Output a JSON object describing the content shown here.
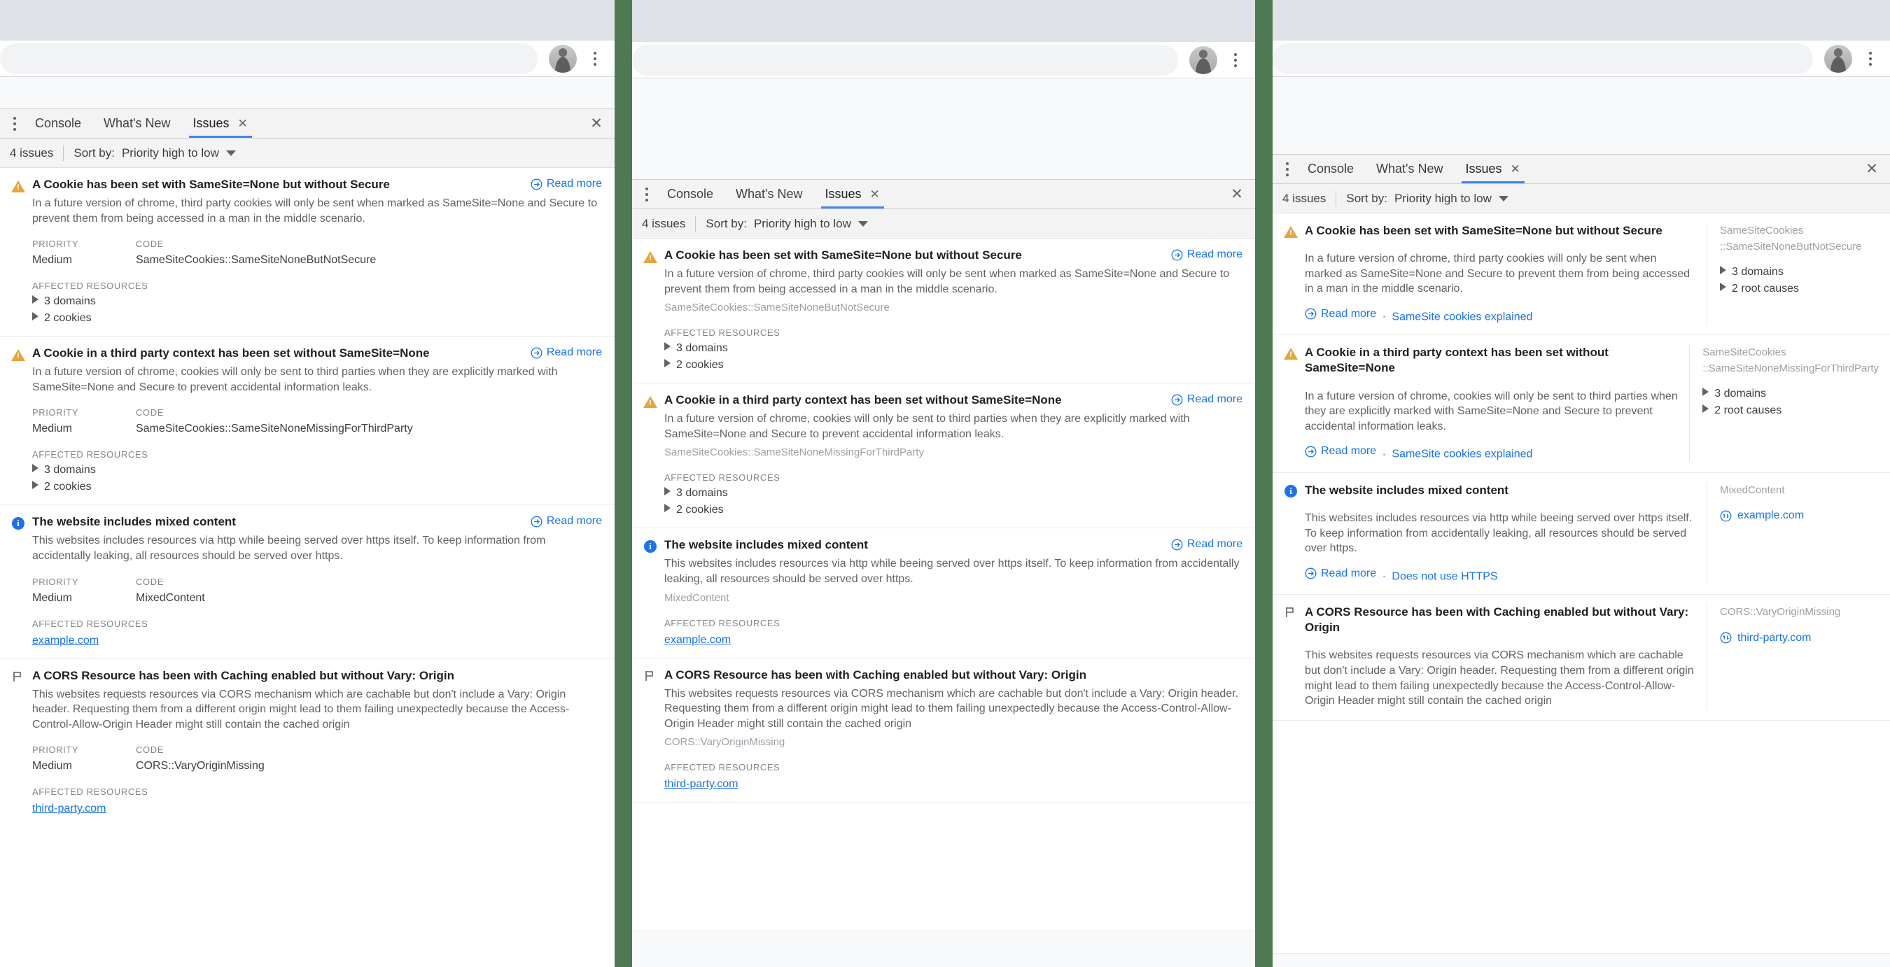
{
  "meta": {
    "divider_color": "#4d7a52",
    "accent_color": "#1a73e8",
    "warning_color": "#e8a33d",
    "tab_underline_color": "#4285f4"
  },
  "devtools": {
    "tabs": [
      {
        "label": "Console",
        "active": false
      },
      {
        "label": "What's New",
        "active": false
      },
      {
        "label": "Issues",
        "active": true,
        "close_glyph": "✕"
      }
    ],
    "close_all_glyph": "✕",
    "toolbar": {
      "issue_count": "4 issues",
      "sort_label": "Sort by:",
      "sort_value": "Priority high to low"
    },
    "labels": {
      "priority": "PRIORITY",
      "code": "CODE",
      "affected_resources": "AFFECTED RESOURCES",
      "read_more": "Read more",
      "separator": "·"
    }
  },
  "issues": [
    {
      "icon": "warning-icon",
      "title": "A Cookie has been set with SameSite=None but without Secure",
      "description": "In a future version of chrome, third party cookies will only be sent when marked as SameSite=None and Secure to prevent them from being accessed in a man in the middle scenario.",
      "priority": "Medium",
      "code": "SameSiteCookies::SameSiteNoneButNotSecure",
      "code_line1": "SameSiteCookies",
      "code_line2": "::SameSiteNoneButNotSecure",
      "resources_a": [
        "3 domains",
        "2 cookies"
      ],
      "resources_c": [
        "3 domains",
        "2 root causes"
      ],
      "read_more": "Read more",
      "explainer": "SameSite cookies explained"
    },
    {
      "icon": "warning-icon",
      "title": "A Cookie in a third party context has been set without SameSite=None",
      "description": "In a future version of chrome, cookies will only be sent to third parties when they are explicitly marked with SameSite=None and Secure to prevent accidental information leaks.",
      "priority": "Medium",
      "code": "SameSiteCookies::SameSiteNoneMissingForThirdParty",
      "code_line1": "SameSiteCookies",
      "code_line2": "::SameSiteNoneMissingForThirdParty",
      "resources_a": [
        "3 domains",
        "2 cookies"
      ],
      "resources_c": [
        "3 domains",
        "2 root causes"
      ],
      "read_more": "Read more",
      "explainer": "SameSite cookies explained"
    },
    {
      "icon": "info-icon",
      "title": "The website includes mixed content",
      "description": "This websites includes resources via http while beeing served over https itself. To keep information from accidentally leaking, all resources should be served over https.",
      "priority": "Medium",
      "code": "MixedContent",
      "code_line1": "MixedContent",
      "code_line2": "",
      "resource_link": "example.com",
      "read_more": "Read more",
      "explainer": "Does not use HTTPS"
    },
    {
      "icon": "flag-icon",
      "title": "A CORS Resource has been with Caching enabled but without Vary: Origin",
      "description": "This websites requests resources via CORS mechanism which are cachable but don't include a Vary: Origin header. Requesting them from a different origin might lead to them failing unexpectedly because the Access-Control-Allow-Origin Header might still contain the cached origin",
      "priority": "Medium",
      "code": "CORS::VaryOriginMissing",
      "code_line1": "CORS::VaryOriginMissing",
      "code_line2": "",
      "resource_link": "third-party.com",
      "read_more": "",
      "explainer": ""
    }
  ]
}
